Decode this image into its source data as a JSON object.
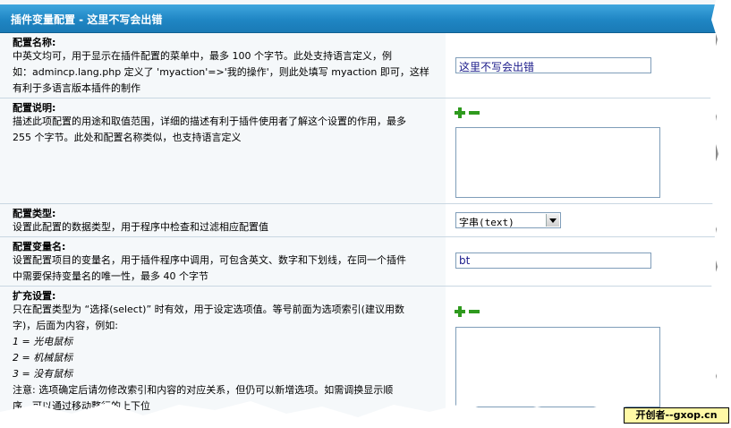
{
  "header": {
    "title": "插件变量配置 - 这里不写会出错"
  },
  "fields": [
    {
      "label": "配置名称:",
      "desc": [
        "中英文均可，用于显示在插件配置的菜单中，最多 100 个字节。此处支持语言定义，例",
        "如：admincp.lang.php 定义了 'myaction'=>'我的操作'，则此处填写 myaction 即可，这样",
        "有利于多语言版本插件的制作"
      ],
      "value": "这里不写会出错"
    },
    {
      "label": "配置说明:",
      "desc": [
        "描述此项配置的用途和取值范围，详细的描述有利于插件使用者了解这个设置的作用，最多",
        "255 个字节。此处和配置名称类似，也支持语言定义"
      ],
      "value": ""
    },
    {
      "label": "配置类型:",
      "desc": [
        "设置此配置的数据类型，用于程序中检查和过滤相应配置值"
      ],
      "value": "字串(text)"
    },
    {
      "label": "配置变量名:",
      "desc": [
        "设置配置项目的变量名，用于插件程序中调用，可包含英文、数字和下划线，在同一个插件",
        "中需要保持变量名的唯一性，最多 40 个字节"
      ],
      "value": "bt"
    },
    {
      "label": "扩充设置:",
      "desc": [
        "只在配置类型为 “选择(select)” 时有效，用于设定选项值。等号前面为选项索引(建议用数",
        "字)，后面为内容，例如:"
      ],
      "examples": [
        "1 = 光电鼠标",
        "2 = 机械鼠标",
        "3 = 没有鼠标"
      ],
      "note": [
        "注意: 选项确定后请勿修改索引和内容的对应关系，但仍可以新增选项。如需调换显示顺",
        "序，可以通过移动整行的上下位"
      ],
      "value": ""
    }
  ],
  "watermark": "开创者--gxop.cn",
  "colors": {
    "header": "#1f86c4",
    "accent": "#2f9a1e"
  }
}
